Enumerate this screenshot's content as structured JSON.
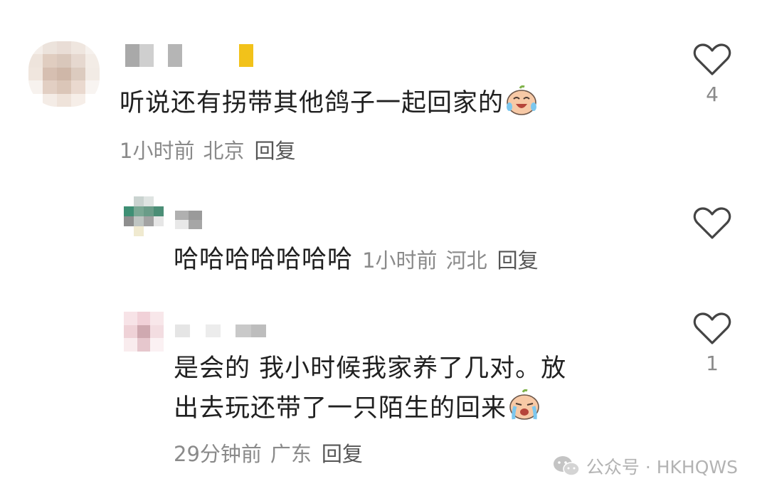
{
  "comments": [
    {
      "text": "听说还有拐带其他鸽子一起回家的",
      "time": "1小时前",
      "location": "北京",
      "reply_label": "回复",
      "like_count": "4",
      "emoji": "laughing-crying-emoji"
    },
    {
      "text": "哈哈哈哈哈哈哈",
      "time": "1小时前",
      "location": "河北",
      "reply_label": "回复",
      "like_count": ""
    },
    {
      "text_line1": "是会的 我小时候我家养了几对。放",
      "text_line2": "出去玩还带了一只陌生的回来",
      "time": "29分钟前",
      "location": "广东",
      "reply_label": "回复",
      "like_count": "1",
      "emoji": "crying-emoji"
    }
  ],
  "watermark": {
    "text": "公众号 · HKHQWS"
  },
  "icons": {
    "like": "heart-outline-icon",
    "wechat": "wechat-icon"
  },
  "colors": {
    "text": "#202020",
    "meta": "#8a8a8a",
    "reply": "#555555",
    "watermark": "#b3b3b3"
  }
}
